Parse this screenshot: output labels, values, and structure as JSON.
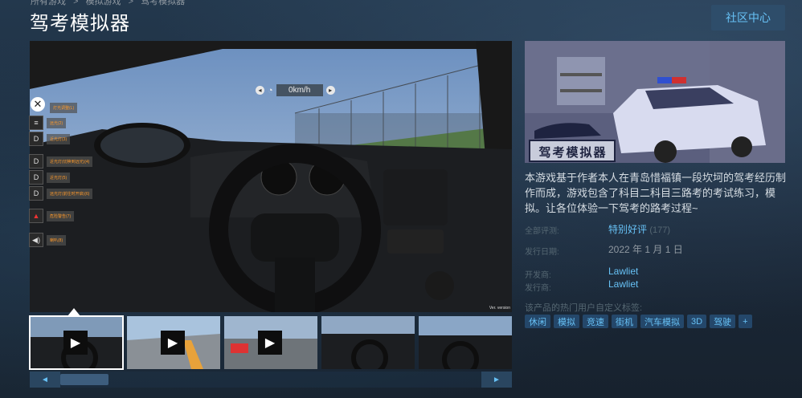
{
  "breadcrumb": [
    "所有游戏",
    ">",
    "模拟游戏",
    ">",
    "驾考模拟器"
  ],
  "title": "驾考模拟器",
  "community_hub": "社区中心",
  "video": {
    "speed": "0km/h",
    "close_label": "✕",
    "menu_items": [
      "灯光调整(L)",
      "远光(2)",
      "近光灯(3)",
      "近光灯(切换到远光)(4)",
      "近光灯(5)",
      "远光灯(前往时开启)(6)",
      "危险警告(7)",
      "喇叭(8)"
    ],
    "version_text": "Ver. version"
  },
  "thumbnails": [
    {
      "kind": "video",
      "play": "▶"
    },
    {
      "kind": "video",
      "play": "▶"
    },
    {
      "kind": "video",
      "play": "▶"
    },
    {
      "kind": "image"
    },
    {
      "kind": "image"
    }
  ],
  "slider": {
    "left": "◄",
    "right": "►"
  },
  "capsule_title": "驾考模拟器",
  "description": "本游戏基于作者本人在青岛惜福镇一段坎坷的驾考经历制作而成，游戏包含了科目二科目三路考的考试练习，模拟。让各位体验一下驾考的路考过程~",
  "info": {
    "reviews_label": "全部评测:",
    "reviews_value": "特别好评",
    "reviews_count": "(177)",
    "release_label": "发行日期:",
    "release_value": "2022 年 1 月 1 日",
    "developer_label": "开发商:",
    "developer_value": "Lawliet",
    "publisher_label": "发行商:",
    "publisher_value": "Lawliet"
  },
  "tags_label": "该产品的热门用户自定义标签:",
  "tags": [
    "休闲",
    "模拟",
    "竞速",
    "街机",
    "汽车模拟",
    "3D",
    "驾驶",
    "+"
  ],
  "colors": {
    "accent": "#67c1f5",
    "bg": "#1b2838",
    "button": "#2e4d6a"
  }
}
